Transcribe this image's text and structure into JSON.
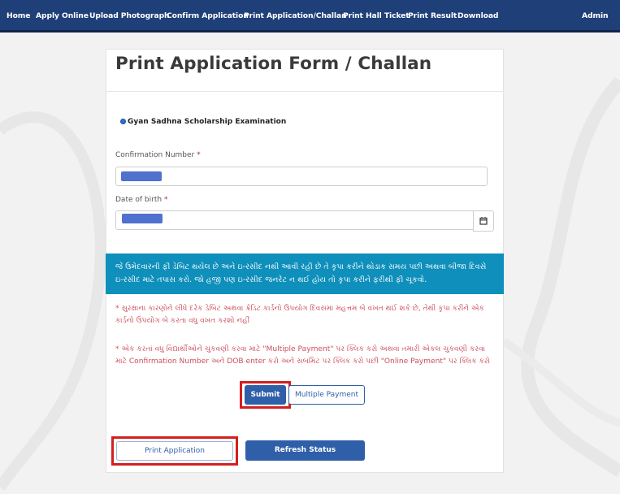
{
  "nav": {
    "items": [
      "Home",
      "Apply Online",
      "Upload Photograph",
      "Confirm Application",
      "Print Application/Challan",
      "Print Hall Ticket",
      "Print Result",
      "Download"
    ],
    "admin": "Admin"
  },
  "page": {
    "title": "Print Application Form / Challan"
  },
  "exam": {
    "option_label": "Gyan Sadhna Scholarship Examination",
    "selected": true
  },
  "form": {
    "confirmation_label": "Confirmation Number",
    "dob_label": "Date of birth",
    "required_mark": "*"
  },
  "notice": {
    "text": "જે ઉમેદવારની ફી ડેબિટ થયેલ છે અને ઇ-રસીદ નથી આવી રહી છે તે કૃપા કરીને થોડાક સમય પછી અથવા બીજા દિવસે ઇ-રસીદ માટે તપાસ કરો. જો હજી પણ ઇ-રસીદ જનરેટ ન થઈ હોય તો કૃપા કરીને ફરીથી ફી ચૂકવો."
  },
  "notes": [
    "* સુરક્ષાના કારણોને લીધે દરેક ડેબિટ અથવા ક્રેડિટ કાર્ડનો ઉપયોગ દિવસમાં મહત્તમ બે વખત થઈ શકે છે, તેથી કૃપા કરીને એક કાર્ડનો ઉપયોગ બે કરતા વધુ વખત કરશો નહીં",
    "* એક કરતાં વધુ વિદ્યાર્થીઓને ચુકવણી કરવા માટે \"Multiple Payment\" પર ક્લિક કરો અથવા તમારી એકલ ચુકવણી કરવા માટે Confirmation Number અને DOB enter કરો અને સબમિટ પર ક્લિક કરો પછી \"Online Payment\" પર ક્લિક કરો"
  ],
  "buttons": {
    "submit": "Submit",
    "multiple_payment": "Multiple Payment",
    "print_application": "Print Application",
    "refresh_status": "Refresh Status"
  },
  "icons": {
    "calendar": "calendar-icon"
  },
  "colors": {
    "navbar": "#1f3f78",
    "notice": "#0f8fbb",
    "primary_button": "#2f5fa8",
    "note_text": "#cc4e5c",
    "highlight": "#d41f1f"
  }
}
